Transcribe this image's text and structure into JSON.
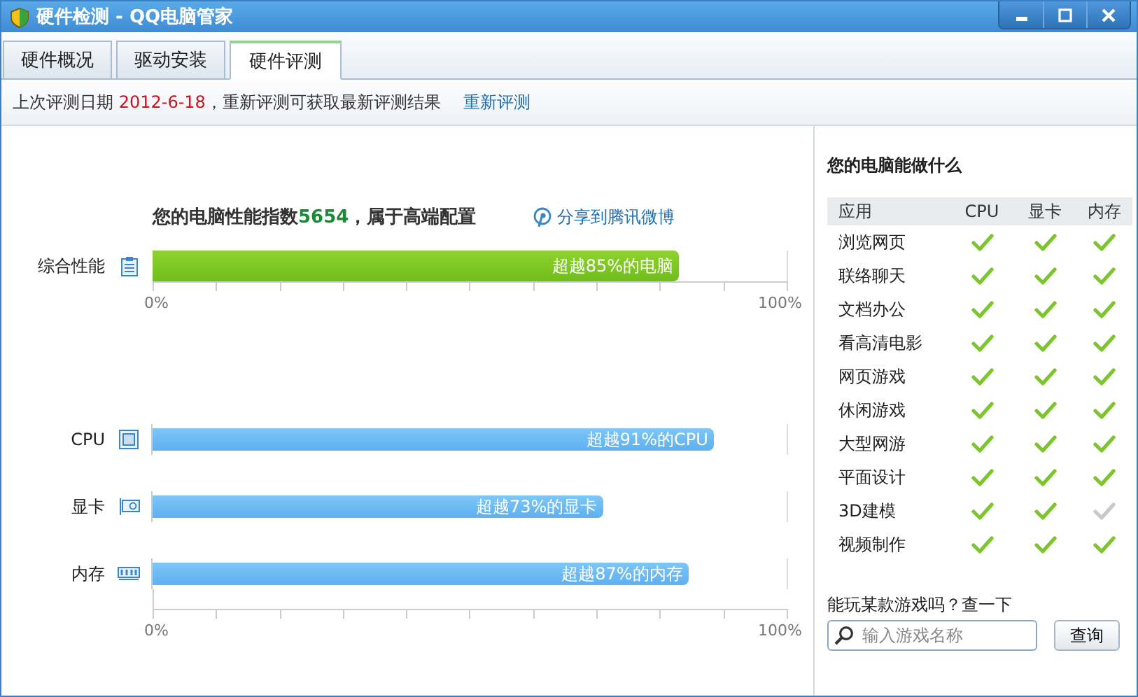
{
  "window": {
    "title": "硬件检测 - QQ电脑管家"
  },
  "tabs": [
    {
      "label": "硬件概况",
      "selected": false
    },
    {
      "label": "驱动安装",
      "selected": false
    },
    {
      "label": "硬件评测",
      "selected": true
    }
  ],
  "info": {
    "prefix": "上次评测日期",
    "date": "2012-6-18",
    "suffix": "，重新评测可获取最新评测结果",
    "link": "重新评测"
  },
  "score": {
    "before": "您的电脑性能指数",
    "value": "5654",
    "after": "，属于高端配置"
  },
  "share": "分享到腾讯微博",
  "overall": {
    "label": "综合性能",
    "level": 0.83,
    "text": "超越85%的电脑"
  },
  "overall_axis": {
    "min": "0%",
    "max": "100%"
  },
  "components": [
    {
      "kind": "cpu",
      "label": "CPU",
      "level": 0.885,
      "text": "超越91%的CPU"
    },
    {
      "kind": "gpu",
      "label": "显卡",
      "level": 0.71,
      "text": "超越73%的显卡"
    },
    {
      "kind": "memory",
      "label": "内存",
      "level": 0.845,
      "text": "超越87%的内存"
    }
  ],
  "component_axis": {
    "min": "0%",
    "max": "100%"
  },
  "capability": {
    "title": "您的电脑能做什么",
    "columns": [
      "应用",
      "CPU",
      "显卡",
      "内存"
    ],
    "rows": [
      {
        "name": "浏览网页",
        "checks": [
          true,
          true,
          true
        ]
      },
      {
        "name": "联络聊天",
        "checks": [
          true,
          true,
          true
        ]
      },
      {
        "name": "文档办公",
        "checks": [
          true,
          true,
          true
        ]
      },
      {
        "name": "看高清电影",
        "checks": [
          true,
          true,
          true
        ]
      },
      {
        "name": "网页游戏",
        "checks": [
          true,
          true,
          true
        ]
      },
      {
        "name": "休闲游戏",
        "checks": [
          true,
          true,
          true
        ]
      },
      {
        "name": "大型网游",
        "checks": [
          true,
          true,
          true
        ]
      },
      {
        "name": "平面设计",
        "checks": [
          true,
          true,
          true
        ]
      },
      {
        "name": "3D建模",
        "checks": [
          true,
          true,
          false
        ]
      },
      {
        "name": "视频制作",
        "checks": [
          true,
          true,
          true
        ]
      }
    ]
  },
  "game_search": {
    "prompt": "能玩某款游戏吗？查一下",
    "placeholder": "输入游戏名称",
    "button": "查询"
  }
}
